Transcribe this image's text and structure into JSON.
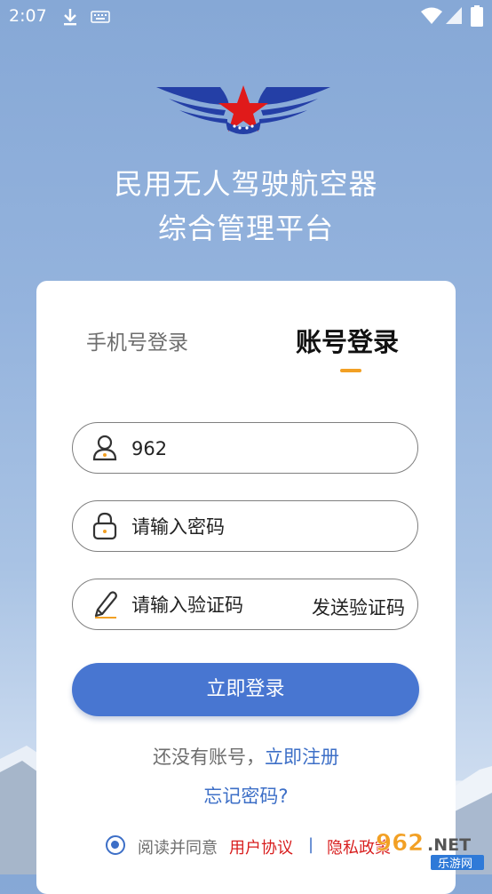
{
  "status_bar": {
    "time": "2:07",
    "icons": [
      "download-icon",
      "keyboard-icon",
      "wifi-icon",
      "signal-icon",
      "battery-icon"
    ]
  },
  "header": {
    "logo": "wings-star-emblem",
    "title_line1": "民用无人驾驶航空器",
    "title_line2": "综合管理平台"
  },
  "tabs": {
    "phone_login": "手机号登录",
    "account_login": "账号登录",
    "active": "account_login",
    "accent_color": "#f2a024"
  },
  "form": {
    "account_value": "962",
    "password_placeholder": "请输入密码",
    "code_placeholder": "请输入验证码",
    "send_code_label": "发送验证码",
    "login_button": "立即登录"
  },
  "links": {
    "no_account_text": "还没有账号，",
    "register": "立即注册",
    "forgot_password": "忘记密码?"
  },
  "agreement": {
    "checked": true,
    "prefix": "阅读并同意",
    "user_agreement": "用户协议",
    "separator": "|",
    "privacy_policy": "隐私政策"
  },
  "watermark": {
    "brand": "962.NET",
    "sub": "乐游网"
  },
  "colors": {
    "primary": "#4876d1",
    "link": "#3d6fc7",
    "danger": "#d81e1e"
  }
}
